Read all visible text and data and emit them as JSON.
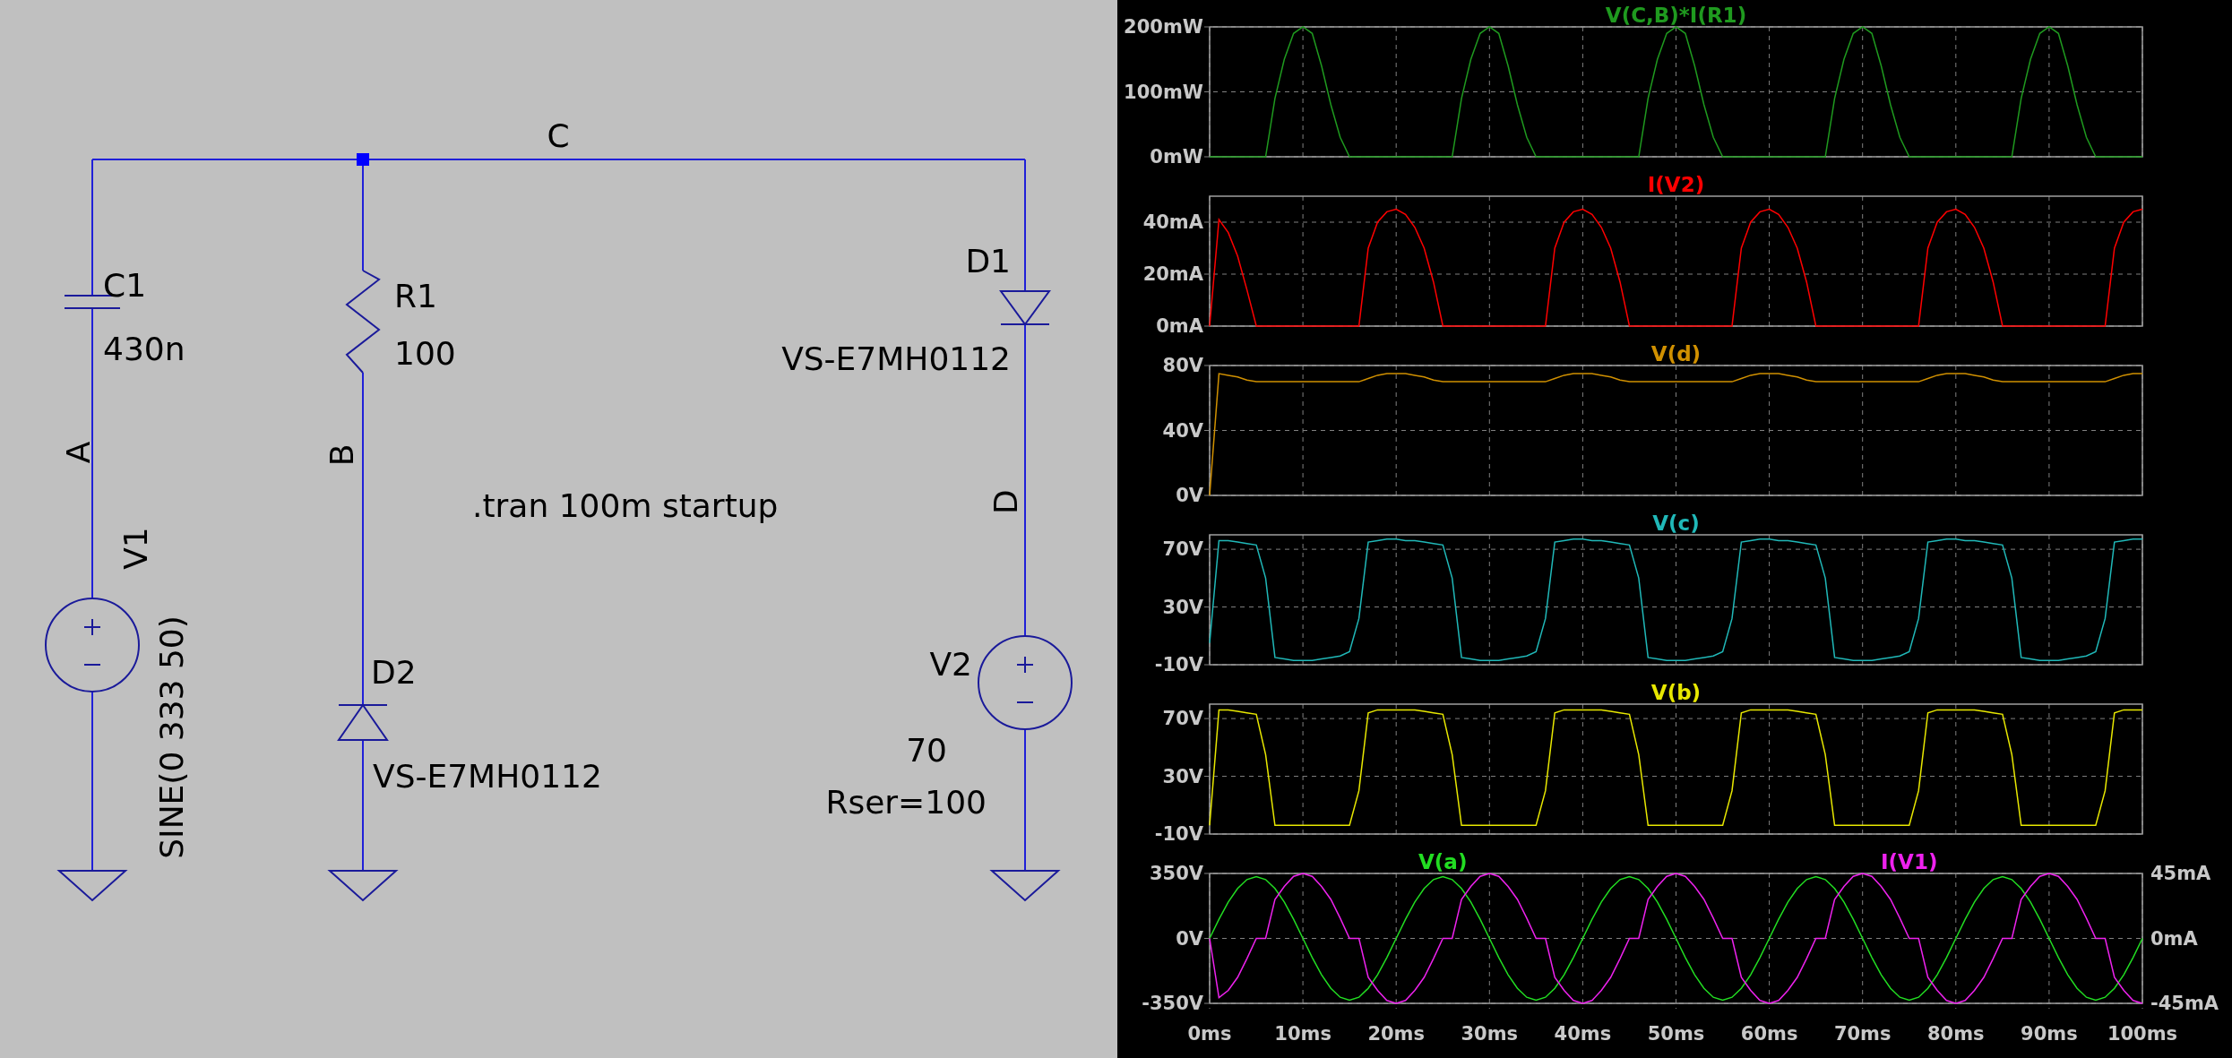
{
  "schematic": {
    "components": [
      {
        "kind": "capacitor",
        "name": "C1",
        "value": "430n"
      },
      {
        "kind": "resistor",
        "name": "R1",
        "value": "100"
      },
      {
        "kind": "diode",
        "name": "D2",
        "value": "VS-E7MH0112"
      },
      {
        "kind": "diode",
        "name": "D1",
        "value": "VS-E7MH0112"
      },
      {
        "kind": "voltage_source",
        "name": "V1",
        "value": "SINE(0 333 50)"
      },
      {
        "kind": "voltage_source",
        "name": "V2",
        "value": "70",
        "parameter": "Rser=100"
      }
    ],
    "nets": [
      "C",
      "A",
      "B",
      "D"
    ],
    "directive": ".tran 100m startup"
  },
  "plots": [
    {
      "chart_data": {
        "type": "line",
        "x": [
          0,
          1,
          2,
          3,
          4,
          5,
          6,
          7,
          8,
          9,
          10,
          11,
          12,
          13,
          14,
          15,
          16,
          17,
          18,
          19,
          20,
          21,
          22,
          23,
          24,
          25,
          26,
          27,
          28,
          29,
          30,
          31,
          32,
          33,
          34,
          35,
          36,
          37,
          38,
          39,
          40,
          41,
          42,
          43,
          44,
          45,
          46,
          47,
          48,
          49,
          50,
          51,
          52,
          53,
          54,
          55,
          56,
          57,
          58,
          59,
          60,
          61,
          62,
          63,
          64,
          65,
          66,
          67,
          68,
          69,
          70,
          71,
          72,
          73,
          74,
          75,
          76,
          77,
          78,
          79,
          80,
          81,
          82,
          83,
          84,
          85,
          86,
          87,
          88,
          89,
          90,
          91,
          92,
          93,
          94,
          95,
          96,
          97,
          98,
          99,
          100
        ],
        "xlim": [
          0,
          100
        ],
        "ylim": [
          0,
          200
        ],
        "grid": true,
        "yticks": [
          {
            "value": 0,
            "label": "0mW"
          },
          {
            "value": 100,
            "label": "100mW"
          },
          {
            "value": 200,
            "label": "200mW"
          }
        ],
        "series": [
          {
            "name": "V(C,B)*I(R1)",
            "color": "#1f9a1f",
            "values": [
              0,
              0,
              0,
              0,
              0,
              0,
              0,
              90,
              150,
              190,
              200,
              190,
              140,
              80,
              30,
              0,
              0,
              0,
              0,
              0,
              0,
              0,
              0,
              0,
              0,
              0,
              0,
              90,
              150,
              190,
              200,
              190,
              140,
              80,
              30,
              0,
              0,
              0,
              0,
              0,
              0,
              0,
              0,
              0,
              0,
              0,
              0,
              90,
              150,
              190,
              200,
              190,
              140,
              80,
              30,
              0,
              0,
              0,
              0,
              0,
              0,
              0,
              0,
              0,
              0,
              0,
              0,
              90,
              150,
              190,
              200,
              190,
              140,
              80,
              30,
              0,
              0,
              0,
              0,
              0,
              0,
              0,
              0,
              0,
              0,
              0,
              0,
              90,
              150,
              190,
              200,
              190,
              140,
              80,
              30,
              0,
              0,
              0,
              0,
              0,
              0
            ]
          }
        ]
      }
    },
    {
      "chart_data": {
        "type": "line",
        "x": [
          0,
          1,
          2,
          3,
          4,
          5,
          6,
          7,
          8,
          9,
          10,
          11,
          12,
          13,
          14,
          15,
          16,
          17,
          18,
          19,
          20,
          21,
          22,
          23,
          24,
          25,
          26,
          27,
          28,
          29,
          30,
          31,
          32,
          33,
          34,
          35,
          36,
          37,
          38,
          39,
          40,
          41,
          42,
          43,
          44,
          45,
          46,
          47,
          48,
          49,
          50,
          51,
          52,
          53,
          54,
          55,
          56,
          57,
          58,
          59,
          60,
          61,
          62,
          63,
          64,
          65,
          66,
          67,
          68,
          69,
          70,
          71,
          72,
          73,
          74,
          75,
          76,
          77,
          78,
          79,
          80,
          81,
          82,
          83,
          84,
          85,
          86,
          87,
          88,
          89,
          90,
          91,
          92,
          93,
          94,
          95,
          96,
          97,
          98,
          99,
          100
        ],
        "xlim": [
          0,
          100
        ],
        "ylim": [
          0,
          50
        ],
        "grid": true,
        "yticks": [
          {
            "value": 0,
            "label": "0mA"
          },
          {
            "value": 20,
            "label": "20mA"
          },
          {
            "value": 40,
            "label": "40mA"
          }
        ],
        "series": [
          {
            "name": "I(V2)",
            "color": "#ff0000",
            "values": [
              0,
              41,
              36,
              27,
              14,
              0,
              0,
              0,
              0,
              0,
              0,
              0,
              0,
              0,
              0,
              0,
              0,
              30,
              40,
              44,
              45,
              43,
              38,
              30,
              17,
              0,
              0,
              0,
              0,
              0,
              0,
              0,
              0,
              0,
              0,
              0,
              0,
              30,
              40,
              44,
              45,
              43,
              38,
              30,
              17,
              0,
              0,
              0,
              0,
              0,
              0,
              0,
              0,
              0,
              0,
              0,
              0,
              30,
              40,
              44,
              45,
              43,
              38,
              30,
              17,
              0,
              0,
              0,
              0,
              0,
              0,
              0,
              0,
              0,
              0,
              0,
              0,
              30,
              40,
              44,
              45,
              43,
              38,
              30,
              17,
              0,
              0,
              0,
              0,
              0,
              0,
              0,
              0,
              0,
              0,
              0,
              0,
              30,
              40,
              44,
              45
            ]
          }
        ]
      }
    },
    {
      "chart_data": {
        "type": "line",
        "x": [
          0,
          1,
          2,
          3,
          4,
          5,
          6,
          7,
          8,
          9,
          10,
          11,
          12,
          13,
          14,
          15,
          16,
          17,
          18,
          19,
          20,
          21,
          22,
          23,
          24,
          25,
          26,
          27,
          28,
          29,
          30,
          31,
          32,
          33,
          34,
          35,
          36,
          37,
          38,
          39,
          40,
          41,
          42,
          43,
          44,
          45,
          46,
          47,
          48,
          49,
          50,
          51,
          52,
          53,
          54,
          55,
          56,
          57,
          58,
          59,
          60,
          61,
          62,
          63,
          64,
          65,
          66,
          67,
          68,
          69,
          70,
          71,
          72,
          73,
          74,
          75,
          76,
          77,
          78,
          79,
          80,
          81,
          82,
          83,
          84,
          85,
          86,
          87,
          88,
          89,
          90,
          91,
          92,
          93,
          94,
          95,
          96,
          97,
          98,
          99,
          100
        ],
        "xlim": [
          0,
          100
        ],
        "ylim": [
          0,
          80
        ],
        "grid": true,
        "yticks": [
          {
            "value": 0,
            "label": "0V"
          },
          {
            "value": 40,
            "label": "40V"
          },
          {
            "value": 80,
            "label": "80V"
          }
        ],
        "series": [
          {
            "name": "V(d)",
            "color": "#d09000",
            "values": [
              0,
              75,
              74,
              73,
              71,
              70,
              70,
              70,
              70,
              70,
              70,
              70,
              70,
              70,
              70,
              70,
              70,
              72,
              74,
              75,
              75,
              75,
              74,
              73,
              71,
              70,
              70,
              70,
              70,
              70,
              70,
              70,
              70,
              70,
              70,
              70,
              70,
              72,
              74,
              75,
              75,
              75,
              74,
              73,
              71,
              70,
              70,
              70,
              70,
              70,
              70,
              70,
              70,
              70,
              70,
              70,
              70,
              72,
              74,
              75,
              75,
              75,
              74,
              73,
              71,
              70,
              70,
              70,
              70,
              70,
              70,
              70,
              70,
              70,
              70,
              70,
              70,
              72,
              74,
              75,
              75,
              75,
              74,
              73,
              71,
              70,
              70,
              70,
              70,
              70,
              70,
              70,
              70,
              70,
              70,
              70,
              70,
              72,
              74,
              75,
              75
            ]
          }
        ]
      }
    },
    {
      "chart_data": {
        "type": "line",
        "x": [
          0,
          1,
          2,
          3,
          4,
          5,
          6,
          7,
          8,
          9,
          10,
          11,
          12,
          13,
          14,
          15,
          16,
          17,
          18,
          19,
          20,
          21,
          22,
          23,
          24,
          25,
          26,
          27,
          28,
          29,
          30,
          31,
          32,
          33,
          34,
          35,
          36,
          37,
          38,
          39,
          40,
          41,
          42,
          43,
          44,
          45,
          46,
          47,
          48,
          49,
          50,
          51,
          52,
          53,
          54,
          55,
          56,
          57,
          58,
          59,
          60,
          61,
          62,
          63,
          64,
          65,
          66,
          67,
          68,
          69,
          70,
          71,
          72,
          73,
          74,
          75,
          76,
          77,
          78,
          79,
          80,
          81,
          82,
          83,
          84,
          85,
          86,
          87,
          88,
          89,
          90,
          91,
          92,
          93,
          94,
          95,
          96,
          97,
          98,
          99,
          100
        ],
        "xlim": [
          0,
          100
        ],
        "ylim": [
          -10,
          80
        ],
        "grid": true,
        "yticks": [
          {
            "value": -10,
            "label": "-10V"
          },
          {
            "value": 30,
            "label": "30V"
          },
          {
            "value": 70,
            "label": "70V"
          }
        ],
        "series": [
          {
            "name": "V(c)",
            "color": "#20b8b8",
            "values": [
              5,
              76,
              76,
              75,
              74,
              73,
              50,
              -5,
              -6,
              -7,
              -7,
              -7,
              -6,
              -5,
              -4,
              -1,
              22,
              75,
              76,
              77,
              77,
              76,
              76,
              75,
              74,
              73,
              50,
              -5,
              -6,
              -7,
              -7,
              -7,
              -6,
              -5,
              -4,
              -1,
              22,
              75,
              76,
              77,
              77,
              76,
              76,
              75,
              74,
              73,
              50,
              -5,
              -6,
              -7,
              -7,
              -7,
              -6,
              -5,
              -4,
              -1,
              22,
              75,
              76,
              77,
              77,
              76,
              76,
              75,
              74,
              73,
              50,
              -5,
              -6,
              -7,
              -7,
              -7,
              -6,
              -5,
              -4,
              -1,
              22,
              75,
              76,
              77,
              77,
              76,
              76,
              75,
              74,
              73,
              50,
              -5,
              -6,
              -7,
              -7,
              -7,
              -6,
              -5,
              -4,
              -1,
              22,
              75,
              76,
              77,
              77
            ]
          }
        ]
      }
    },
    {
      "chart_data": {
        "type": "line",
        "x": [
          0,
          1,
          2,
          3,
          4,
          5,
          6,
          7,
          8,
          9,
          10,
          11,
          12,
          13,
          14,
          15,
          16,
          17,
          18,
          19,
          20,
          21,
          22,
          23,
          24,
          25,
          26,
          27,
          28,
          29,
          30,
          31,
          32,
          33,
          34,
          35,
          36,
          37,
          38,
          39,
          40,
          41,
          42,
          43,
          44,
          45,
          46,
          47,
          48,
          49,
          50,
          51,
          52,
          53,
          54,
          55,
          56,
          57,
          58,
          59,
          60,
          61,
          62,
          63,
          64,
          65,
          66,
          67,
          68,
          69,
          70,
          71,
          72,
          73,
          74,
          75,
          76,
          77,
          78,
          79,
          80,
          81,
          82,
          83,
          84,
          85,
          86,
          87,
          88,
          89,
          90,
          91,
          92,
          93,
          94,
          95,
          96,
          97,
          98,
          99,
          100
        ],
        "xlim": [
          0,
          100
        ],
        "ylim": [
          -10,
          80
        ],
        "grid": true,
        "yticks": [
          {
            "value": -10,
            "label": "-10V"
          },
          {
            "value": 30,
            "label": "30V"
          },
          {
            "value": 70,
            "label": "70V"
          }
        ],
        "series": [
          {
            "name": "V(b)",
            "color": "#e8e800",
            "values": [
              -4,
              76,
              76,
              75,
              74,
              73,
              45,
              -4,
              -4,
              -4,
              -4,
              -4,
              -4,
              -4,
              -4,
              -4,
              20,
              74,
              76,
              76,
              76,
              76,
              76,
              75,
              74,
              73,
              45,
              -4,
              -4,
              -4,
              -4,
              -4,
              -4,
              -4,
              -4,
              -4,
              20,
              74,
              76,
              76,
              76,
              76,
              76,
              75,
              74,
              73,
              45,
              -4,
              -4,
              -4,
              -4,
              -4,
              -4,
              -4,
              -4,
              -4,
              20,
              74,
              76,
              76,
              76,
              76,
              76,
              75,
              74,
              73,
              45,
              -4,
              -4,
              -4,
              -4,
              -4,
              -4,
              -4,
              -4,
              -4,
              20,
              74,
              76,
              76,
              76,
              76,
              76,
              75,
              74,
              73,
              45,
              -4,
              -4,
              -4,
              -4,
              -4,
              -4,
              -4,
              -4,
              -4,
              20,
              74,
              76,
              76,
              76
            ]
          }
        ]
      }
    },
    {
      "chart_data": {
        "type": "line",
        "x": [
          0,
          1,
          2,
          3,
          4,
          5,
          6,
          7,
          8,
          9,
          10,
          11,
          12,
          13,
          14,
          15,
          16,
          17,
          18,
          19,
          20,
          21,
          22,
          23,
          24,
          25,
          26,
          27,
          28,
          29,
          30,
          31,
          32,
          33,
          34,
          35,
          36,
          37,
          38,
          39,
          40,
          41,
          42,
          43,
          44,
          45,
          46,
          47,
          48,
          49,
          50,
          51,
          52,
          53,
          54,
          55,
          56,
          57,
          58,
          59,
          60,
          61,
          62,
          63,
          64,
          65,
          66,
          67,
          68,
          69,
          70,
          71,
          72,
          73,
          74,
          75,
          76,
          77,
          78,
          79,
          80,
          81,
          82,
          83,
          84,
          85,
          86,
          87,
          88,
          89,
          90,
          91,
          92,
          93,
          94,
          95,
          96,
          97,
          98,
          99,
          100
        ],
        "xlim": [
          0,
          100
        ],
        "ylim": [
          -350,
          350
        ],
        "grid": true,
        "yticks": [
          {
            "value": -350,
            "label": "-350V"
          },
          {
            "value": 0,
            "label": "0V"
          },
          {
            "value": 350,
            "label": "350V"
          }
        ],
        "y2lim": [
          -45,
          45
        ],
        "y2ticks": [
          {
            "value": -45,
            "label": "-45mA"
          },
          {
            "value": 0,
            "label": "0mA"
          },
          {
            "value": 45,
            "label": "45mA"
          }
        ],
        "xticks": [
          {
            "value": 0,
            "label": "0ms"
          },
          {
            "value": 10,
            "label": "10ms"
          },
          {
            "value": 20,
            "label": "20ms"
          },
          {
            "value": 30,
            "label": "30ms"
          },
          {
            "value": 40,
            "label": "40ms"
          },
          {
            "value": 50,
            "label": "50ms"
          },
          {
            "value": 60,
            "label": "60ms"
          },
          {
            "value": 70,
            "label": "70ms"
          },
          {
            "value": 80,
            "label": "80ms"
          },
          {
            "value": 90,
            "label": "90ms"
          },
          {
            "value": 100,
            "label": "100ms"
          }
        ],
        "series": [
          {
            "name": "V(a)",
            "color": "#22dd22",
            "values": [
              0,
              103,
              196,
              269,
              317,
              333,
              317,
              269,
              196,
              103,
              0,
              -103,
              -196,
              -269,
              -317,
              -333,
              -317,
              -269,
              -196,
              -103,
              0,
              103,
              196,
              269,
              317,
              333,
              317,
              269,
              196,
              103,
              0,
              -103,
              -196,
              -269,
              -317,
              -333,
              -317,
              -269,
              -196,
              -103,
              0,
              103,
              196,
              269,
              317,
              333,
              317,
              269,
              196,
              103,
              0,
              -103,
              -196,
              -269,
              -317,
              -333,
              -317,
              -269,
              -196,
              -103,
              0,
              103,
              196,
              269,
              317,
              333,
              317,
              269,
              196,
              103,
              0,
              -103,
              -196,
              -269,
              -317,
              -333,
              -317,
              -269,
              -196,
              -103,
              0,
              103,
              196,
              269,
              317,
              333,
              317,
              269,
              196,
              103,
              0,
              -103,
              -196,
              -269,
              -317,
              -333,
              -317,
              -269,
              -196,
              -103,
              0
            ]
          },
          {
            "name": "I(V1)",
            "color": "#ee22ee",
            "axis": "y2",
            "values": [
              0,
              -41,
              -36,
              -27,
              -14,
              0,
              0,
              27,
              36,
              43,
              45,
              43,
              36,
              27,
              14,
              0,
              0,
              -27,
              -36,
              -43,
              -45,
              -43,
              -36,
              -27,
              -14,
              0,
              0,
              27,
              36,
              43,
              45,
              43,
              36,
              27,
              14,
              0,
              0,
              -27,
              -36,
              -43,
              -45,
              -43,
              -36,
              -27,
              -14,
              0,
              0,
              27,
              36,
              43,
              45,
              43,
              36,
              27,
              14,
              0,
              0,
              -27,
              -36,
              -43,
              -45,
              -43,
              -36,
              -27,
              -14,
              0,
              0,
              27,
              36,
              43,
              45,
              43,
              36,
              27,
              14,
              0,
              0,
              -27,
              -36,
              -43,
              -45,
              -43,
              -36,
              -27,
              -14,
              0,
              0,
              27,
              36,
              43,
              45,
              43,
              36,
              27,
              14,
              0,
              0,
              -27,
              -36,
              -43,
              -45
            ]
          }
        ]
      }
    }
  ]
}
